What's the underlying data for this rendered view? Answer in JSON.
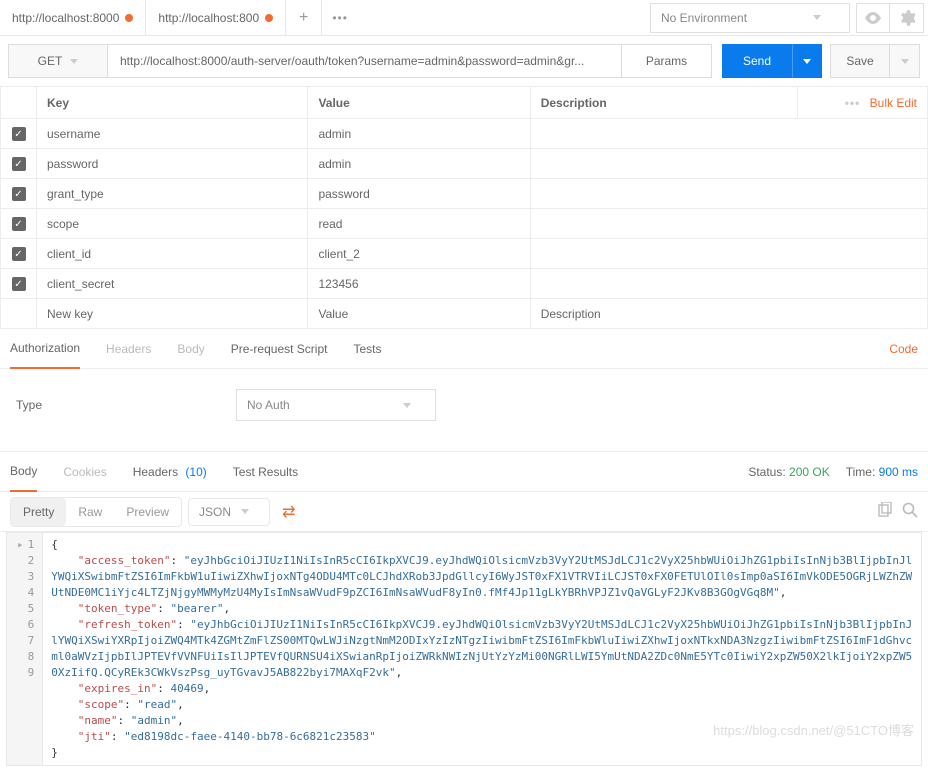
{
  "topbar": {
    "tabs": [
      {
        "label": "http://localhost:8000",
        "modified": true
      },
      {
        "label": "http://localhost:800",
        "modified": true
      }
    ],
    "environment": "No Environment"
  },
  "request": {
    "method": "GET",
    "url": "http://localhost:8000/auth-server/oauth/token?username=admin&password=admin&gr...",
    "params_btn": "Params",
    "send": "Send",
    "save": "Save"
  },
  "params": {
    "headers": {
      "key": "Key",
      "value": "Value",
      "description": "Description",
      "bulk": "Bulk Edit"
    },
    "rows": [
      {
        "key": "username",
        "value": "admin",
        "checked": true
      },
      {
        "key": "password",
        "value": "admin",
        "checked": true
      },
      {
        "key": "grant_type",
        "value": "password",
        "checked": true
      },
      {
        "key": "scope",
        "value": "read",
        "checked": true
      },
      {
        "key": "client_id",
        "value": "client_2",
        "checked": true
      },
      {
        "key": "client_secret",
        "value": "123456",
        "checked": true
      }
    ],
    "new_placeholder": {
      "key": "New key",
      "value": "Value",
      "description": "Description"
    }
  },
  "req_tabs": {
    "authorization": "Authorization",
    "headers": "Headers",
    "body": "Body",
    "prerequest": "Pre-request Script",
    "tests": "Tests",
    "code": "Code"
  },
  "auth": {
    "type_label": "Type",
    "value": "No Auth"
  },
  "resp_tabs": {
    "body": "Body",
    "cookies": "Cookies",
    "headers": "Headers",
    "headers_count": "(10)",
    "tests": "Test Results"
  },
  "resp_status": {
    "status_label": "Status:",
    "status_value": "200 OK",
    "time_label": "Time:",
    "time_value": "900 ms"
  },
  "view": {
    "pretty": "Pretty",
    "raw": "Raw",
    "preview": "Preview",
    "format": "JSON"
  },
  "response": {
    "access_token": "eyJhbGciOiJIUzI1NiIsInR5cCI6IkpXVCJ9.eyJhdWQiOlsicmVzb3VyY2UtMSJdLCJ1c2VyX25hbWUiOiJhZG1pbiIsInNjb3BlIjpbInJlYWQiXSwibmFtZSI6ImFkbW1uIiwiZXhwIjoxNTg4ODU4MTc0LCJhdXRob3JpdGllcyI6WyJST0xFX1VTRVIiLCJST0xFX0FETUlOIl0sImp0aSI6ImVkODE5OGRjLWZhZWUtNDE0MC1iYjc4LTZjNjgyMWMyMzU4MyIsImNsaWVudF9pZCI6ImNsaWVudF8yIn0.fMf4Jp11gLkYBRhVPJZ1vQaVGLyF2JKv8B3GOgVGq8M",
    "token_type": "bearer",
    "refresh_token": "eyJhbGciOiJIUzI1NiIsInR5cCI6IkpXVCJ9.eyJhdWQiOlsicmVzb3VyY2UtMSJdLCJ1c2VyX25hbWUiOiJhZG1pbiIsInNjb3BlIjpbInJlYWQiXSwiYXRpIjoiZWQ4MTk4ZGMtZmFlZS00MTQwLWJiNzgtNmM2ODIxYzIzNTgzIiwibmFtZSI6ImFkbWluIiwiZXhwIjoxNTkxNDA3NzgzIiwibmFtZSI6ImF1dGhvcml0aWVzIjpbIlJPTEVfVVNFUiIsIlJPTEVfQURNSU4iXSwianRpIjoiZWRkNWIzNjUtYzYzMi00NGRlLWI5YmUtNDA2ZDc0NmE5YTc0IiwiY2xpZW50X2lkIjoiY2xpZW50XzIifQ.QCyREk3CWkVszPsg_uyTGvavJ5AB822byi7MAXqF2vk",
    "expires_in": 40469,
    "scope": "read",
    "name": "admin",
    "jti": "ed8198dc-faee-4140-bb78-6c6821c23583"
  },
  "watermark": "https://blog.csdn.net/@51CTO博客"
}
